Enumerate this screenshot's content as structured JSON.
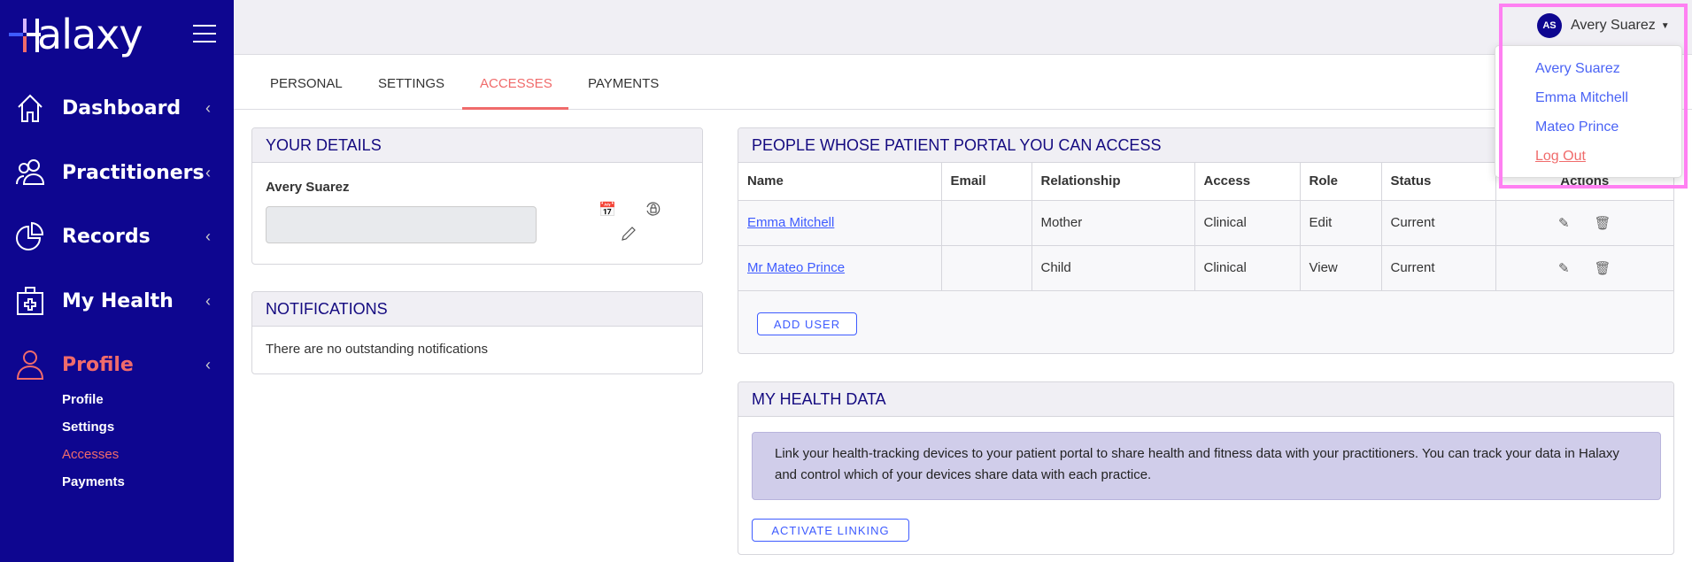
{
  "brand": {
    "name": "Halaxy",
    "sidebar_color": "#0e0690",
    "accent": "#f06b6b",
    "link": "#3e5bff"
  },
  "sidebar": {
    "items": [
      {
        "label": "Dashboard",
        "icon": "home-icon"
      },
      {
        "label": "Practitioners",
        "icon": "users-icon"
      },
      {
        "label": "Records",
        "icon": "pie-chart-icon"
      },
      {
        "label": "My Health",
        "icon": "medical-kit-icon"
      },
      {
        "label": "Profile",
        "icon": "user-icon",
        "active": true
      }
    ],
    "sub_items": [
      {
        "label": "Profile"
      },
      {
        "label": "Settings"
      },
      {
        "label": "Accesses",
        "active": true
      },
      {
        "label": "Payments"
      }
    ]
  },
  "user": {
    "initials": "AS",
    "name": "Avery Suarez"
  },
  "dropdown": {
    "items": [
      "Avery Suarez",
      "Emma Mitchell",
      "Mateo Prince"
    ],
    "logout": "Log Out"
  },
  "tabs": [
    "PERSONAL",
    "SETTINGS",
    "ACCESSES",
    "PAYMENTS"
  ],
  "details": {
    "title": "YOUR DETAILS",
    "name": "Avery Suarez",
    "input_value": ""
  },
  "notifications": {
    "title": "NOTIFICATIONS",
    "message": "There are no outstanding notifications"
  },
  "access": {
    "title": "PEOPLE WHOSE PATIENT PORTAL YOU CAN ACCESS",
    "columns": [
      "Name",
      "Email",
      "Relationship",
      "Access",
      "Role",
      "Status",
      "Actions"
    ],
    "rows": [
      {
        "name": "Emma Mitchell",
        "email": "",
        "relationship": "Mother",
        "access": "Clinical",
        "role": "Edit",
        "status": "Current"
      },
      {
        "name": "Mr Mateo Prince",
        "email": "",
        "relationship": "Child",
        "access": "Clinical",
        "role": "View",
        "status": "Current"
      }
    ],
    "add_button": "ADD USER"
  },
  "health": {
    "title": "MY HEALTH DATA",
    "info": "Link your health-tracking devices to your patient portal to share health and fitness data with your practitioners. You can track your data in Halaxy and control which of your devices share data with each practice.",
    "button": "ACTIVATE LINKING"
  }
}
